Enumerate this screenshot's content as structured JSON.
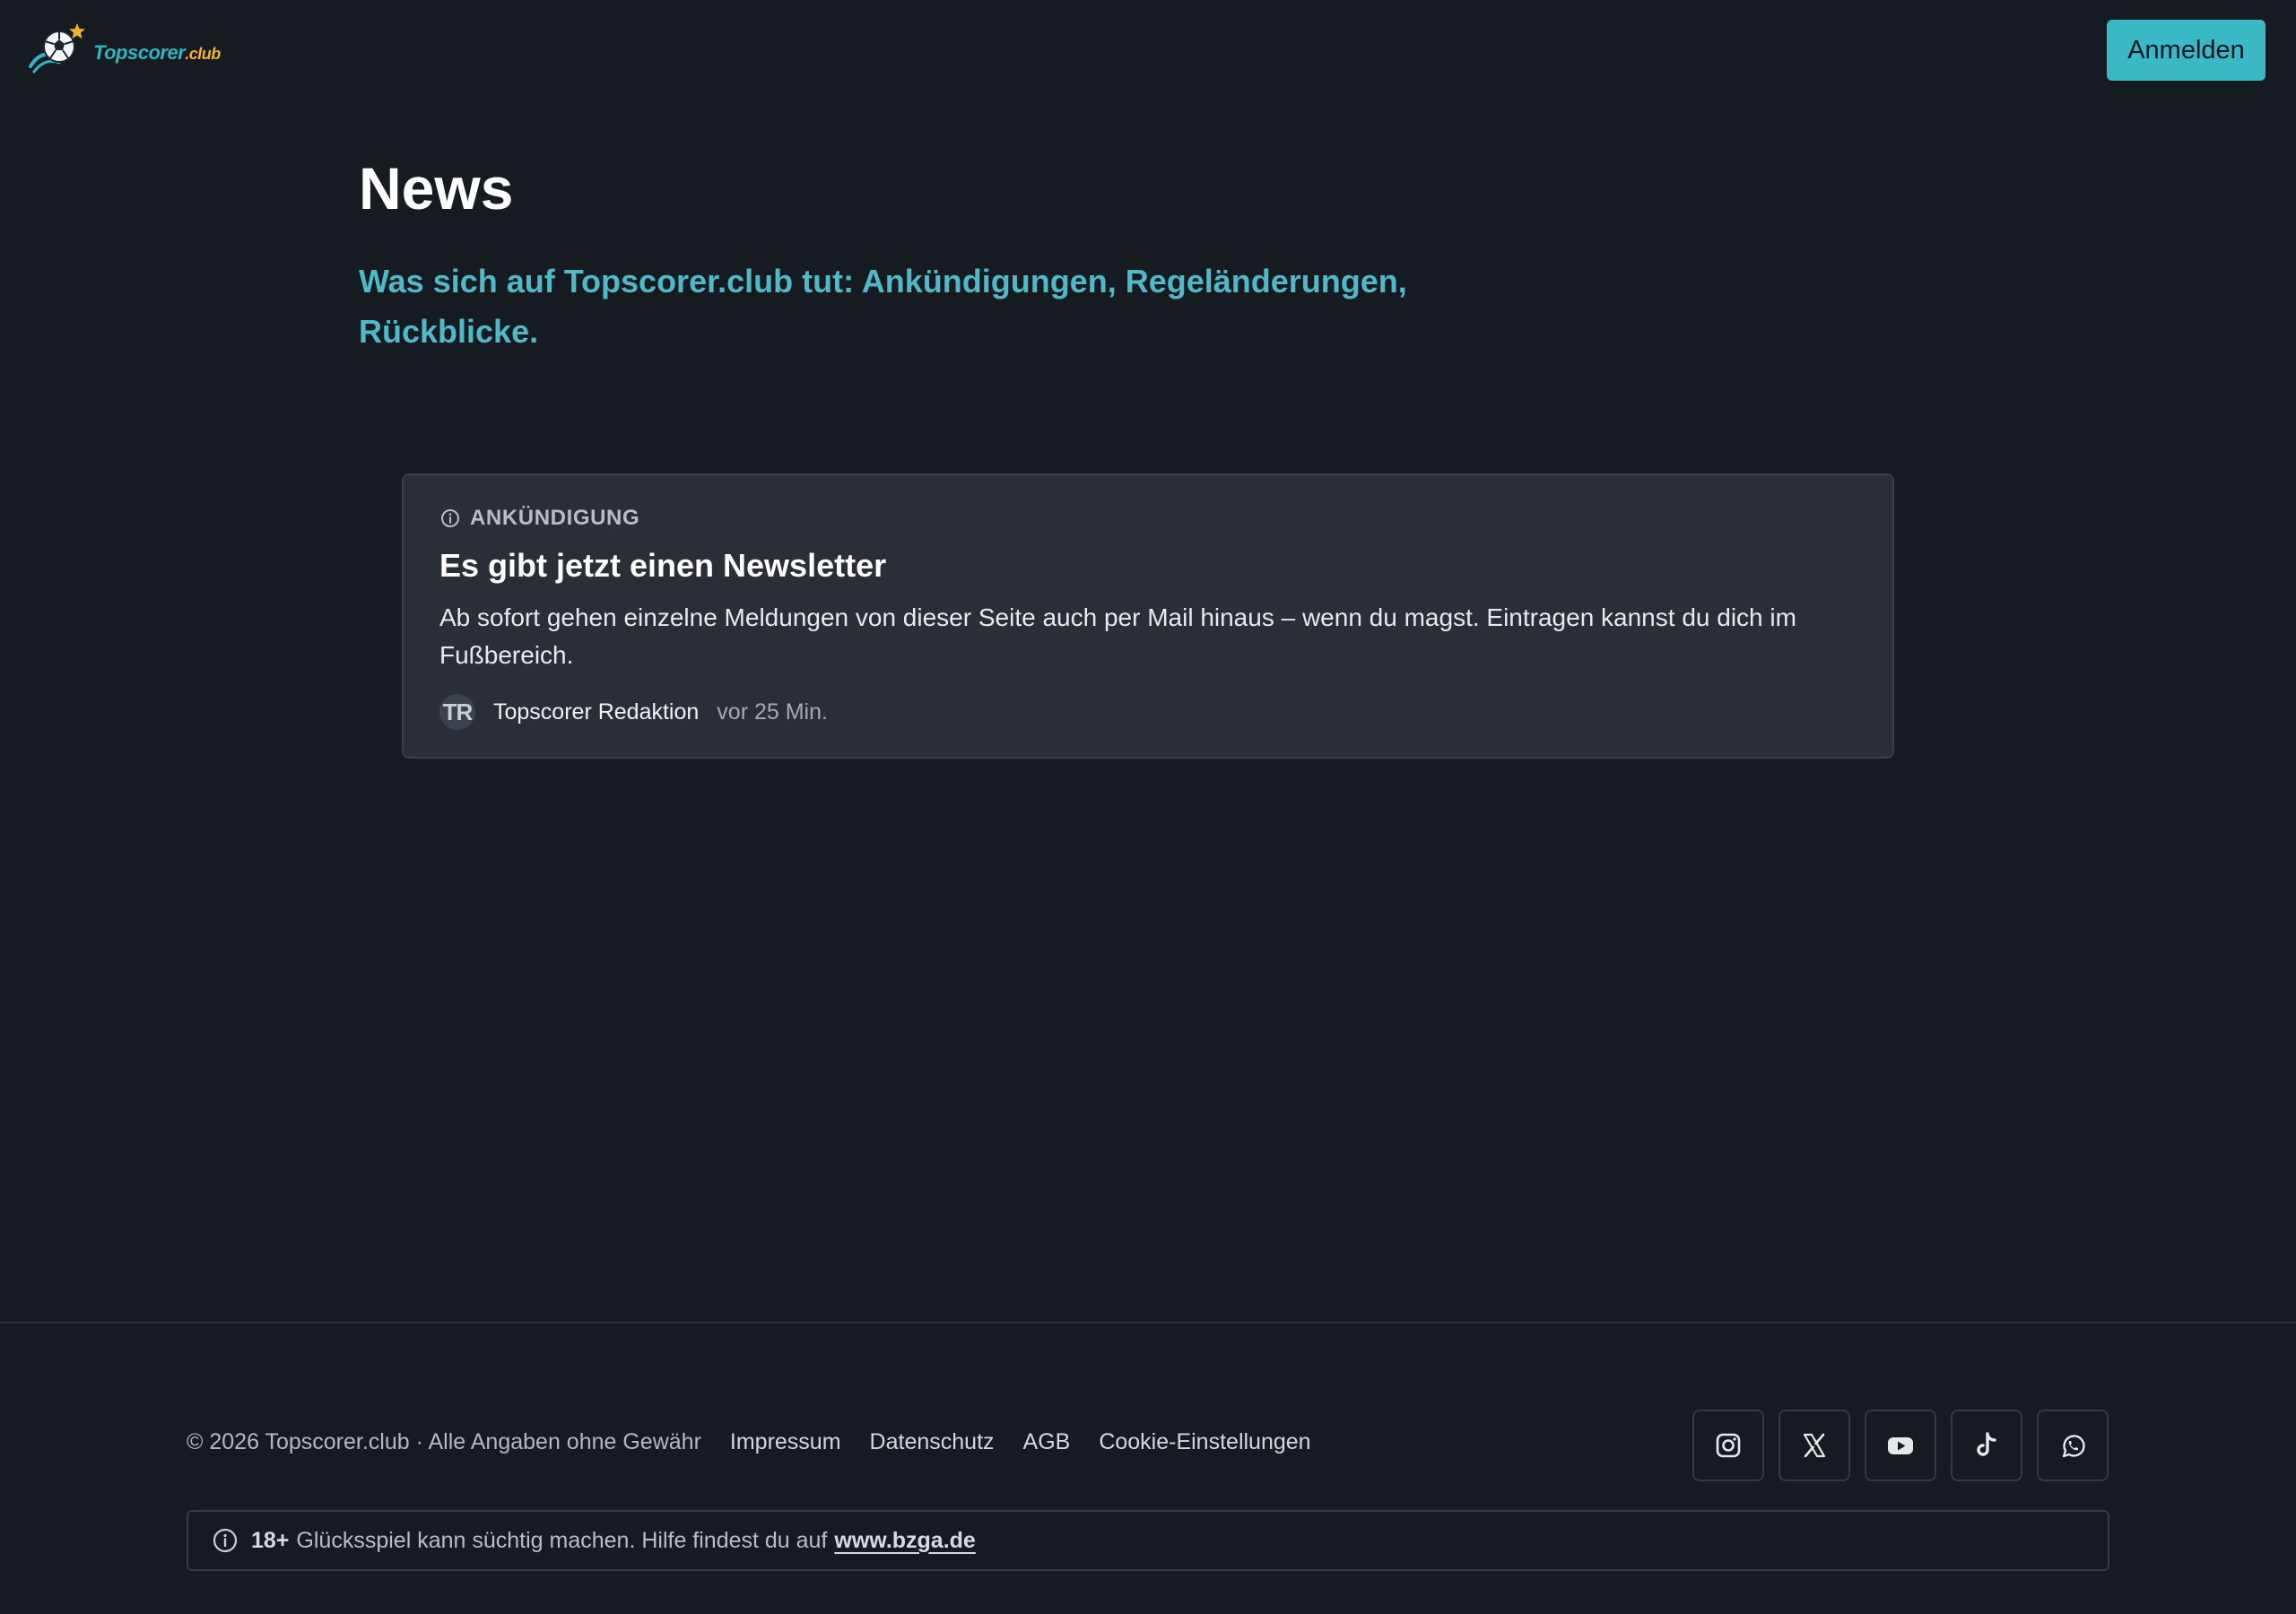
{
  "header": {
    "logo": {
      "name": "Topscorer",
      "tld": ".club"
    },
    "login_label": "Anmelden"
  },
  "hero": {
    "title": "News",
    "subtitle": "Was sich auf Topscorer.club tut: Ankündigungen, Regeländerungen, Rückblicke."
  },
  "news": [
    {
      "category": "ANKÜNDIGUNG",
      "category_icon": "info-icon",
      "title": "Es gibt jetzt einen Newsletter",
      "body": "Ab sofort gehen einzelne Meldungen von dieser Seite auch per Mail hinaus – wenn du magst. Eintragen kannst du dich im Fußbereich.",
      "author_initials": "TR",
      "author": "Topscorer Redaktion",
      "time": "vor 25 Min."
    }
  ],
  "footer": {
    "copyright": "© 2026 Topscorer.club · Alle Angaben ohne Gewähr",
    "links": [
      "Impressum",
      "Datenschutz",
      "AGB",
      "Cookie-Einstellungen"
    ],
    "socials": [
      "instagram-icon",
      "x-icon",
      "youtube-icon",
      "tiktok-icon",
      "whatsapp-icon"
    ],
    "notice": {
      "age": "18+",
      "text": "Glücksspiel kann süchtig machen. Hilfe findest du auf",
      "link": "www.bzga.de"
    }
  },
  "colors": {
    "background": "#161b22",
    "accent": "#3bb8c5",
    "card": "#2a2e36"
  }
}
